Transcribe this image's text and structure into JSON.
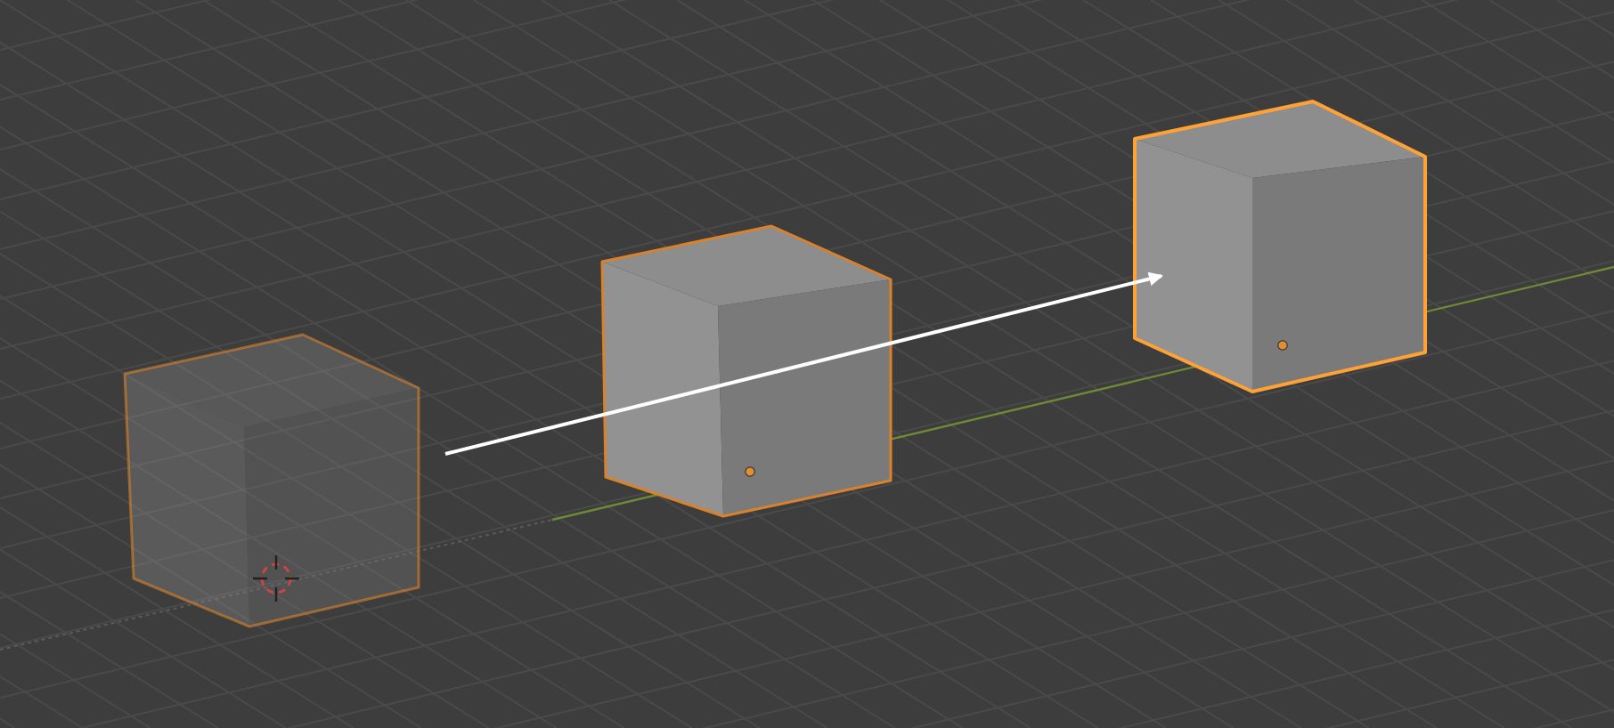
{
  "viewport": {
    "objects": [
      {
        "kind": "ghost",
        "selected": true,
        "active": false
      },
      {
        "kind": "solid",
        "selected": true,
        "active": false
      },
      {
        "kind": "solid",
        "selected": true,
        "active": true
      }
    ]
  }
}
